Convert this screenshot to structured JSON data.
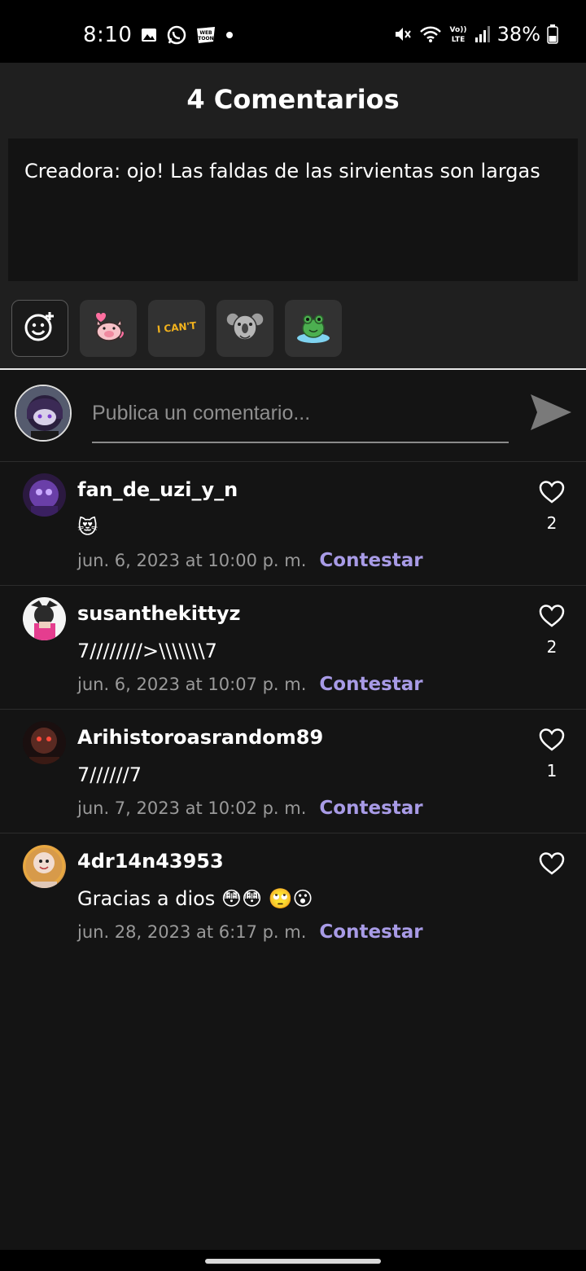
{
  "status_bar": {
    "time": "8:10",
    "battery": "38%",
    "network": "LTE",
    "volte": "Vo))",
    "left_icons": [
      "gallery-icon",
      "whatsapp-icon",
      "webtoon-icon",
      "dot-icon"
    ],
    "right_icons": [
      "mute-icon",
      "wifi-icon",
      "volte-lte-icon",
      "signal-icon",
      "battery-icon"
    ]
  },
  "header": {
    "title": "4 Comentarios"
  },
  "creator_note": {
    "text": "Creadora: ojo! Las faldas de las sirvientas son largas"
  },
  "sticker_bar": {
    "items": [
      "add-emoji-icon",
      "pig-sticker",
      "i-cant-sticker",
      "koala-sticker",
      "frog-sticker"
    ],
    "i_cant_label": "I CAN'T"
  },
  "compose": {
    "placeholder": "Publica un comentario..."
  },
  "comments": [
    {
      "user": "fan_de_uzi_y_n",
      "text": "😻",
      "date": "jun. 6, 2023 at 10:00 p. m.",
      "reply": "Contestar",
      "likes": "2"
    },
    {
      "user": "susanthekittyz",
      "text": "7////////>\\\\\\\\\\\\\\7",
      "date": "jun. 6, 2023 at 10:07 p. m.",
      "reply": "Contestar",
      "likes": "2"
    },
    {
      "user": "Arihistoroasrandom89",
      "text": "7//////7",
      "date": "jun. 7, 2023 at 10:02 p. m.",
      "reply": "Contestar",
      "likes": "1"
    },
    {
      "user": "4dr14n43953",
      "text": "Gracias a dios 😳😳 🙄😮",
      "date": "jun. 28, 2023 at 6:17 p. m.",
      "reply": "Contestar",
      "likes": ""
    }
  ],
  "colors": {
    "background": "#141414",
    "panel": "#1f1f1f",
    "accent_reply": "#a89be6",
    "muted_text": "#9a9a9a"
  }
}
